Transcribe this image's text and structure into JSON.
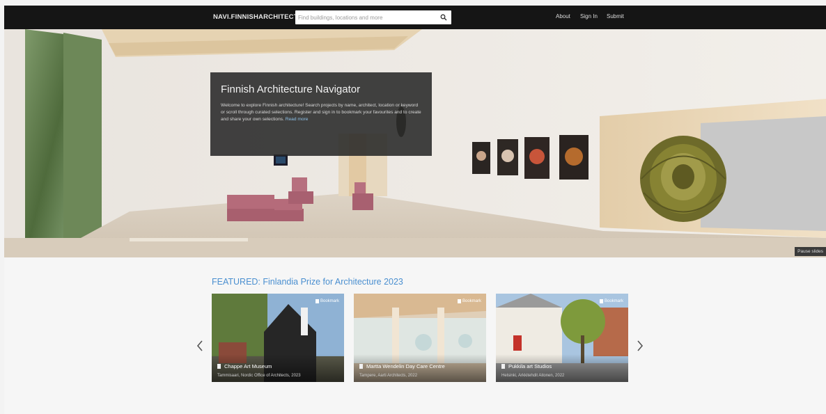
{
  "header": {
    "logo": "NAVI.FINNISHARCHITECTURE.FI",
    "search_placeholder": "Find buildings, locations and more",
    "nav": [
      {
        "label": "About"
      },
      {
        "label": "Sign In"
      },
      {
        "label": "Submit"
      }
    ]
  },
  "hero": {
    "title": "Finnish Architecture Navigator",
    "text": "Welcome to explore Finnish architecture! Search projects by name, architect, location or keyword or scroll through curated selections. Register and sign in to bookmark your favourites and to create and share your own selections.",
    "read_more": "Read more",
    "pause_label": "Pause slides"
  },
  "featured": {
    "title": "FEATURED: Finlandia Prize for Architecture 2023",
    "cards": [
      {
        "name": "Chappe Art Museum",
        "meta": "Tammisaari, Nordic Office of Architects, 2023",
        "bookmark": "Bookmark"
      },
      {
        "name": "Martta Wendelin Day Care Centre",
        "meta": "Tampere, Aarti Architects, 2022",
        "bookmark": "Bookmark"
      },
      {
        "name": "Pukkila art Studios",
        "meta": "Helsinki, Arkkitehdit Aitonen, 2022",
        "bookmark": "Bookmark"
      }
    ]
  },
  "colors": {
    "topbar": "#151515",
    "accent": "#4a8fd0",
    "panel": "#282828"
  },
  "icons": {
    "search": "search-icon",
    "prev": "chevron-left-icon",
    "next": "chevron-right-icon",
    "bookmark": "bookmark-icon",
    "building": "building-icon"
  }
}
